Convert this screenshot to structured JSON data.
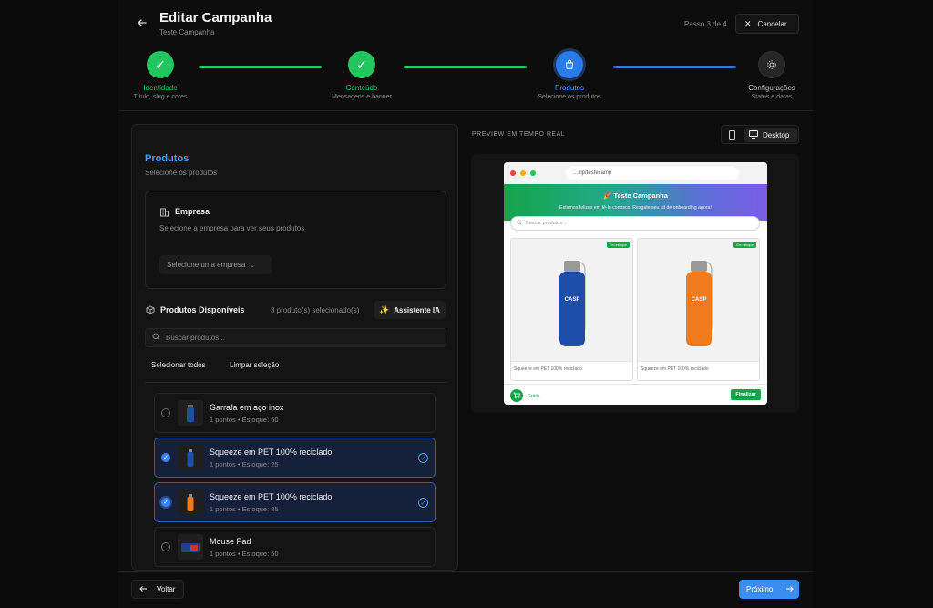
{
  "header": {
    "title": "Editar Campanha",
    "subtitle": "Teste Campanha",
    "step_indicator": "Passo 3 de 4",
    "cancel_label": "Cancelar"
  },
  "steps": [
    {
      "label": "Identidade",
      "sub": "Título, slug e cores",
      "status": "done"
    },
    {
      "label": "Conteúdo",
      "sub": "Mensagens e banner",
      "status": "done"
    },
    {
      "label": "Produtos",
      "sub": "Selecione os produtos",
      "status": "active"
    },
    {
      "label": "Configurações",
      "sub": "Status e datas",
      "status": "pending"
    }
  ],
  "panel": {
    "title": "Produtos",
    "subtitle": "Selecione os produtos",
    "empresa": {
      "title": "Empresa",
      "description": "Selecione a empresa para ver seus produtos",
      "select_placeholder": "Selecione uma empresa"
    },
    "available": {
      "title": "Produtos Disponíveis",
      "count_text": "3 produto(s) selecionado(s)",
      "ai_button": "Assistente IA"
    },
    "search_placeholder": "Buscar produtos...",
    "select_all": "Selecionar todos",
    "clear_selection": "Limpar seleção",
    "products": [
      {
        "name": "Garrafa em aço inox",
        "meta": "1 pontos • Estoque: 50",
        "selected": false
      },
      {
        "name": "Squeeze em PET 100% reciclado",
        "meta": "1 pontos • Estoque: 25",
        "selected": true
      },
      {
        "name": "Squeeze em PET 100% reciclado",
        "meta": "1 pontos • Estoque: 25",
        "selected": true
      },
      {
        "name": "Mouse Pad",
        "meta": "1 pontos • Estoque: 50",
        "selected": false
      }
    ]
  },
  "preview": {
    "label": "PREVIEW EM TEMPO REAL",
    "desktop_label": "Desktop",
    "url": "..../lp/testecamp",
    "banner_title": "🎉 Teste Campanha",
    "banner_sub": "Estamos felizes em tê-lo conosco. Resgate seu kit de onboarding agora!",
    "search_placeholder": "Buscar produtos...",
    "cards": [
      {
        "name": "Squeeze em PET 100% reciclado",
        "badge": "Em estoque",
        "color": "#1e4fa8"
      },
      {
        "name": "Squeeze em PET 100% reciclado",
        "badge": "Em estoque",
        "color": "#f27a1a"
      }
    ],
    "cart_text": "Grátis",
    "finish_label": "Finalizar"
  },
  "footer": {
    "back_label": "Voltar",
    "next_label": "Próximo"
  },
  "colors": {
    "accent": "#3b82f6",
    "success": "#22c55e",
    "background": "#0a0a0a"
  }
}
